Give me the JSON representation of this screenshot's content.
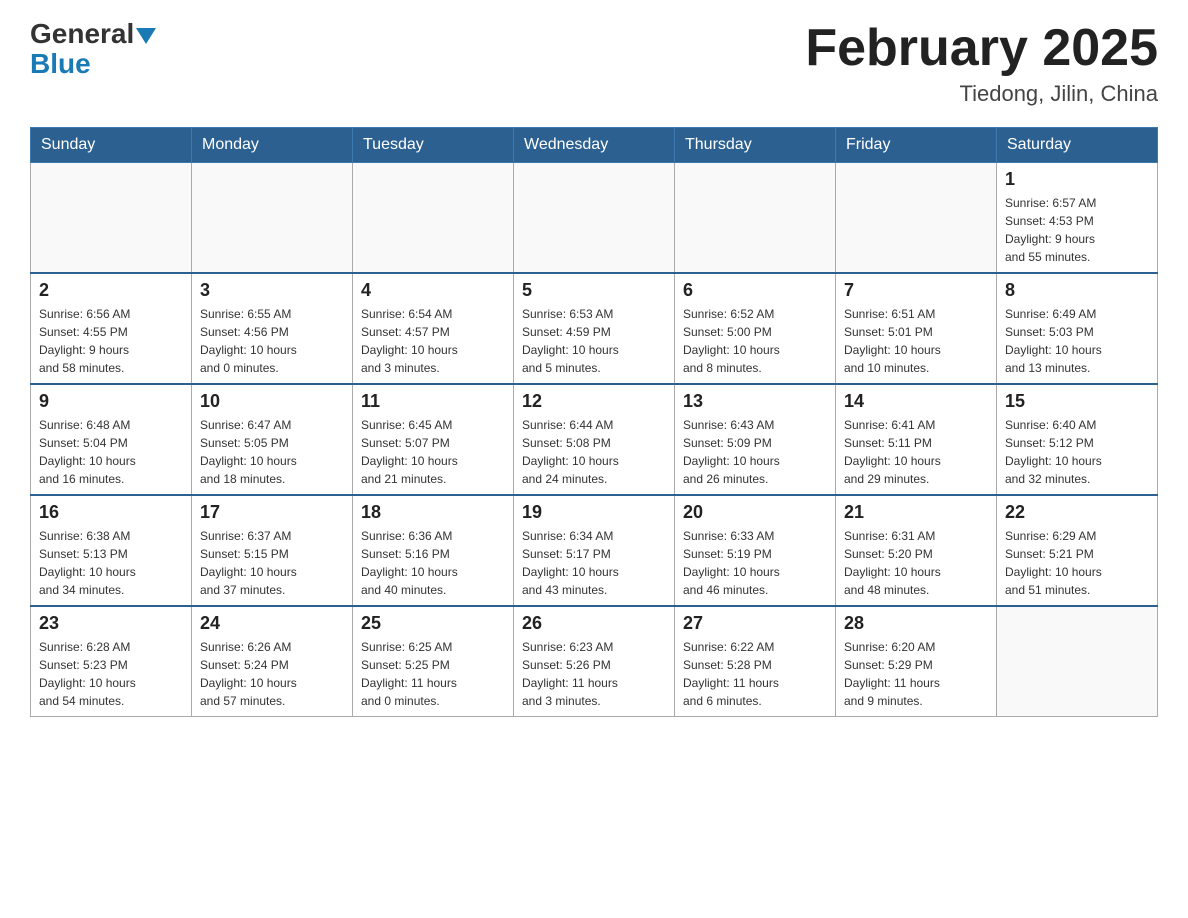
{
  "header": {
    "logo_general": "General",
    "logo_blue": "Blue",
    "month_title": "February 2025",
    "location": "Tiedong, Jilin, China"
  },
  "weekdays": [
    "Sunday",
    "Monday",
    "Tuesday",
    "Wednesday",
    "Thursday",
    "Friday",
    "Saturday"
  ],
  "weeks": [
    [
      {
        "day": "",
        "info": ""
      },
      {
        "day": "",
        "info": ""
      },
      {
        "day": "",
        "info": ""
      },
      {
        "day": "",
        "info": ""
      },
      {
        "day": "",
        "info": ""
      },
      {
        "day": "",
        "info": ""
      },
      {
        "day": "1",
        "info": "Sunrise: 6:57 AM\nSunset: 4:53 PM\nDaylight: 9 hours\nand 55 minutes."
      }
    ],
    [
      {
        "day": "2",
        "info": "Sunrise: 6:56 AM\nSunset: 4:55 PM\nDaylight: 9 hours\nand 58 minutes."
      },
      {
        "day": "3",
        "info": "Sunrise: 6:55 AM\nSunset: 4:56 PM\nDaylight: 10 hours\nand 0 minutes."
      },
      {
        "day": "4",
        "info": "Sunrise: 6:54 AM\nSunset: 4:57 PM\nDaylight: 10 hours\nand 3 minutes."
      },
      {
        "day": "5",
        "info": "Sunrise: 6:53 AM\nSunset: 4:59 PM\nDaylight: 10 hours\nand 5 minutes."
      },
      {
        "day": "6",
        "info": "Sunrise: 6:52 AM\nSunset: 5:00 PM\nDaylight: 10 hours\nand 8 minutes."
      },
      {
        "day": "7",
        "info": "Sunrise: 6:51 AM\nSunset: 5:01 PM\nDaylight: 10 hours\nand 10 minutes."
      },
      {
        "day": "8",
        "info": "Sunrise: 6:49 AM\nSunset: 5:03 PM\nDaylight: 10 hours\nand 13 minutes."
      }
    ],
    [
      {
        "day": "9",
        "info": "Sunrise: 6:48 AM\nSunset: 5:04 PM\nDaylight: 10 hours\nand 16 minutes."
      },
      {
        "day": "10",
        "info": "Sunrise: 6:47 AM\nSunset: 5:05 PM\nDaylight: 10 hours\nand 18 minutes."
      },
      {
        "day": "11",
        "info": "Sunrise: 6:45 AM\nSunset: 5:07 PM\nDaylight: 10 hours\nand 21 minutes."
      },
      {
        "day": "12",
        "info": "Sunrise: 6:44 AM\nSunset: 5:08 PM\nDaylight: 10 hours\nand 24 minutes."
      },
      {
        "day": "13",
        "info": "Sunrise: 6:43 AM\nSunset: 5:09 PM\nDaylight: 10 hours\nand 26 minutes."
      },
      {
        "day": "14",
        "info": "Sunrise: 6:41 AM\nSunset: 5:11 PM\nDaylight: 10 hours\nand 29 minutes."
      },
      {
        "day": "15",
        "info": "Sunrise: 6:40 AM\nSunset: 5:12 PM\nDaylight: 10 hours\nand 32 minutes."
      }
    ],
    [
      {
        "day": "16",
        "info": "Sunrise: 6:38 AM\nSunset: 5:13 PM\nDaylight: 10 hours\nand 34 minutes."
      },
      {
        "day": "17",
        "info": "Sunrise: 6:37 AM\nSunset: 5:15 PM\nDaylight: 10 hours\nand 37 minutes."
      },
      {
        "day": "18",
        "info": "Sunrise: 6:36 AM\nSunset: 5:16 PM\nDaylight: 10 hours\nand 40 minutes."
      },
      {
        "day": "19",
        "info": "Sunrise: 6:34 AM\nSunset: 5:17 PM\nDaylight: 10 hours\nand 43 minutes."
      },
      {
        "day": "20",
        "info": "Sunrise: 6:33 AM\nSunset: 5:19 PM\nDaylight: 10 hours\nand 46 minutes."
      },
      {
        "day": "21",
        "info": "Sunrise: 6:31 AM\nSunset: 5:20 PM\nDaylight: 10 hours\nand 48 minutes."
      },
      {
        "day": "22",
        "info": "Sunrise: 6:29 AM\nSunset: 5:21 PM\nDaylight: 10 hours\nand 51 minutes."
      }
    ],
    [
      {
        "day": "23",
        "info": "Sunrise: 6:28 AM\nSunset: 5:23 PM\nDaylight: 10 hours\nand 54 minutes."
      },
      {
        "day": "24",
        "info": "Sunrise: 6:26 AM\nSunset: 5:24 PM\nDaylight: 10 hours\nand 57 minutes."
      },
      {
        "day": "25",
        "info": "Sunrise: 6:25 AM\nSunset: 5:25 PM\nDaylight: 11 hours\nand 0 minutes."
      },
      {
        "day": "26",
        "info": "Sunrise: 6:23 AM\nSunset: 5:26 PM\nDaylight: 11 hours\nand 3 minutes."
      },
      {
        "day": "27",
        "info": "Sunrise: 6:22 AM\nSunset: 5:28 PM\nDaylight: 11 hours\nand 6 minutes."
      },
      {
        "day": "28",
        "info": "Sunrise: 6:20 AM\nSunset: 5:29 PM\nDaylight: 11 hours\nand 9 minutes."
      },
      {
        "day": "",
        "info": ""
      }
    ]
  ]
}
